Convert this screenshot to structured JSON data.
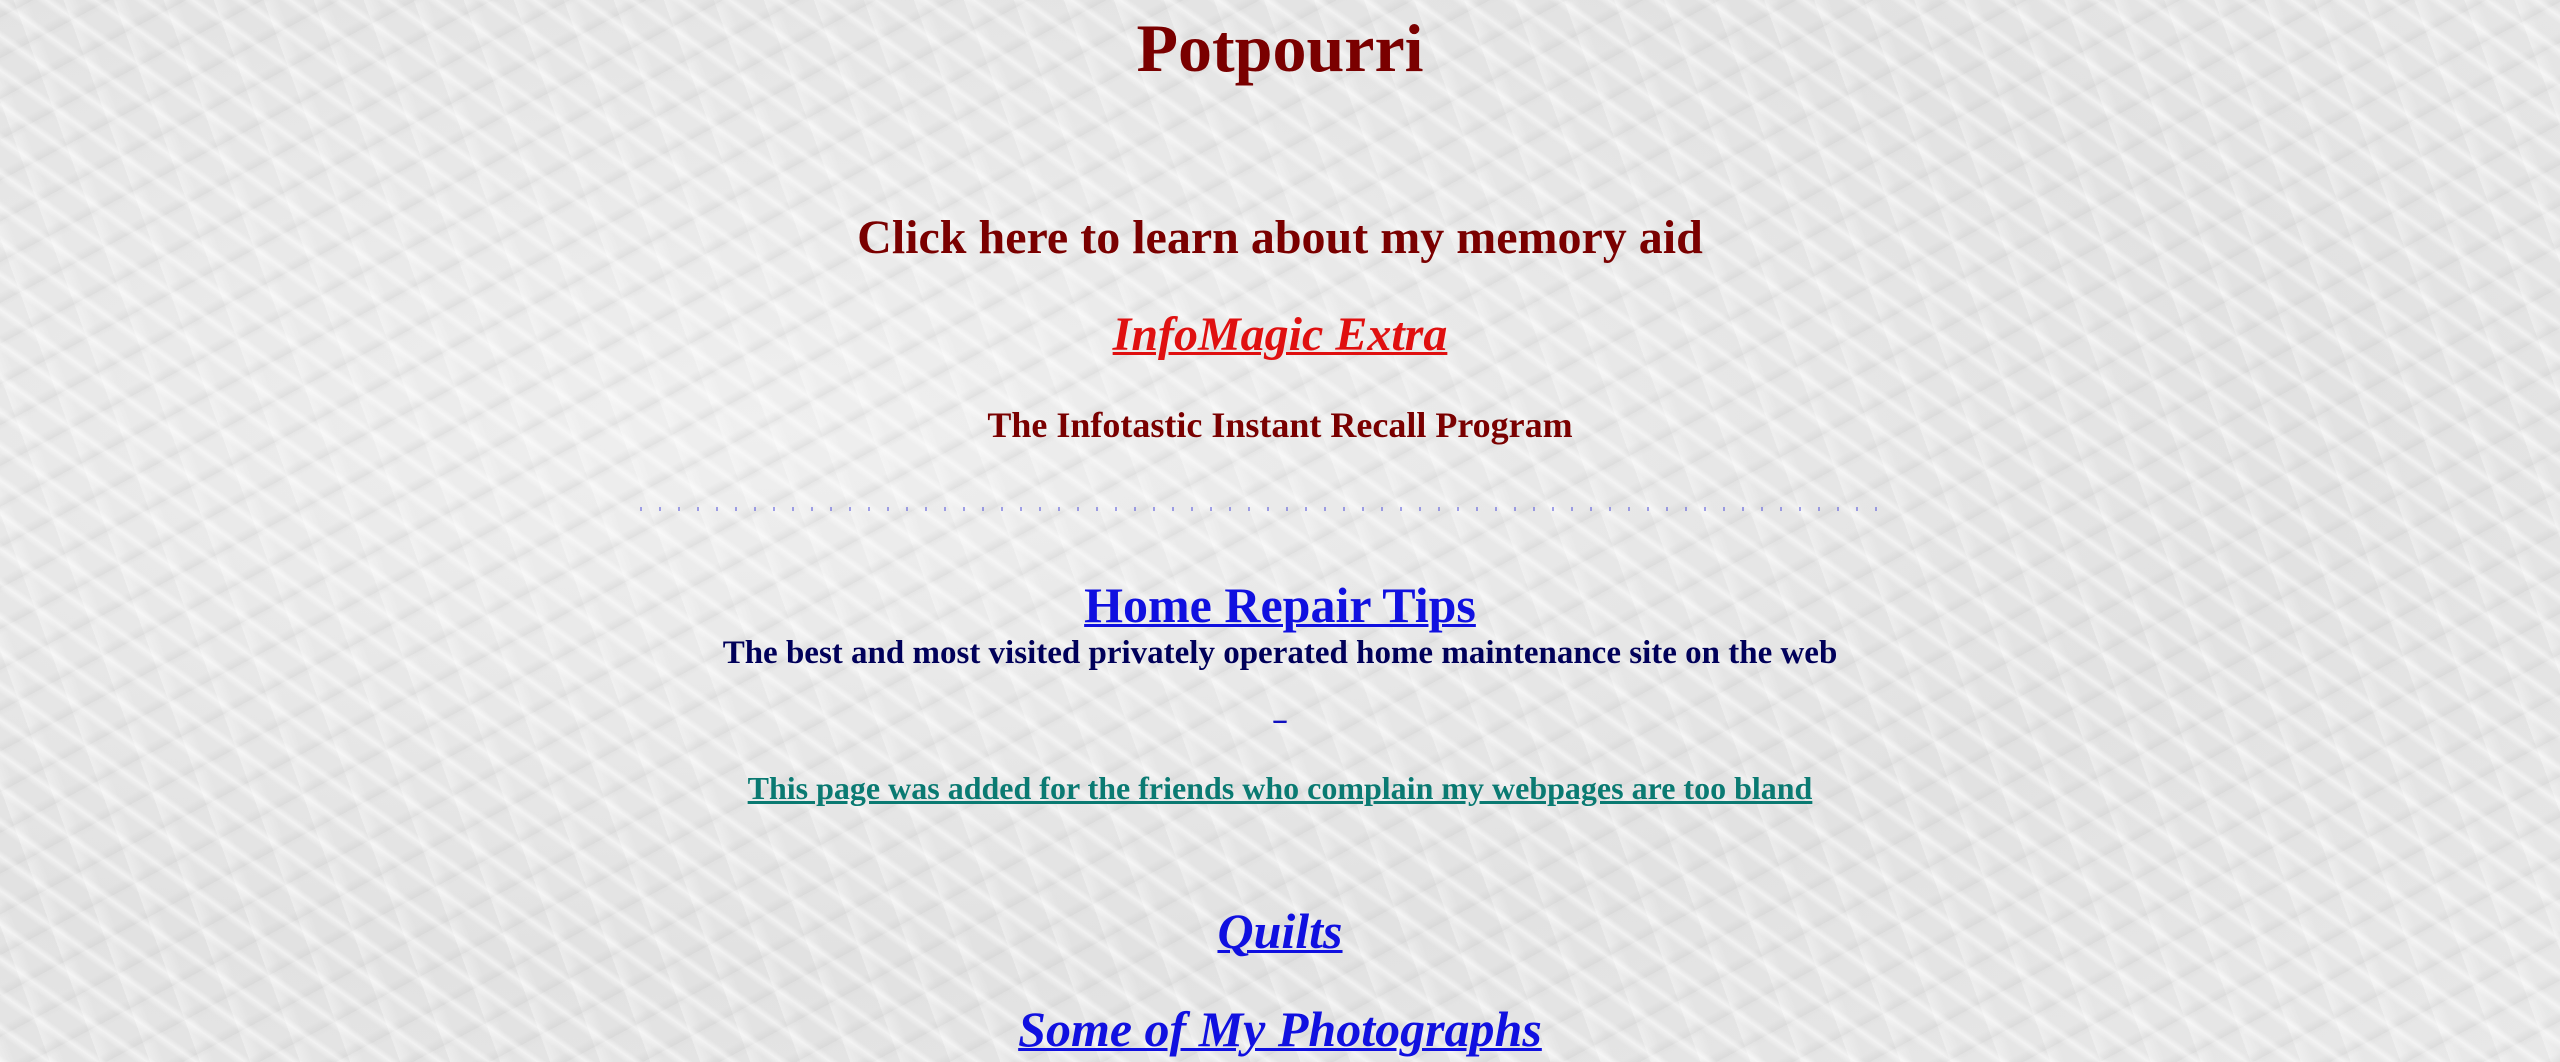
{
  "page": {
    "title": "Potpourri"
  },
  "memory_aid": {
    "heading": "Click here to learn about my memory aid",
    "link_label": "InfoMagic Extra",
    "subtitle": "The Infotastic Instant Recall Program"
  },
  "home_repair": {
    "link_label": "Home Repair Tips",
    "description": "The best and most visited privately operated home maintenance site on the web",
    "tiny_link_label": "_"
  },
  "note": {
    "link_label": "This page was added for the friends who complain my webpages are too bland"
  },
  "links": {
    "quilts": "Quilts",
    "photographs": "Some of My Photographs"
  },
  "colors": {
    "heading": "#7a0000",
    "red_link": "#e01010",
    "blue_link": "#1010e0",
    "dark_navy": "#00005a",
    "teal_link": "#0a7a72",
    "background": "#e6e6e6"
  }
}
